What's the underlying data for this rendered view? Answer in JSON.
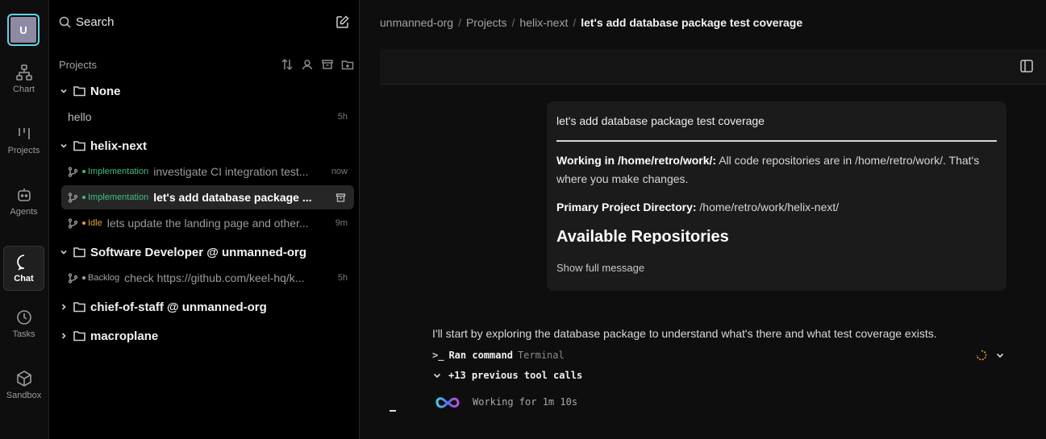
{
  "rail": {
    "avatar_letter": "U",
    "items": [
      {
        "label": "Chart",
        "icon": "chart-icon"
      },
      {
        "label": "Projects",
        "icon": "projects-icon"
      },
      {
        "label": "Agents",
        "icon": "agents-icon"
      },
      {
        "label": "Chat",
        "icon": "chat-icon",
        "active": true
      },
      {
        "label": "Tasks",
        "icon": "clock-icon"
      },
      {
        "label": "Sandbox",
        "icon": "cube-icon"
      }
    ]
  },
  "sidebar": {
    "search_label": "Search",
    "projects_header": "Projects",
    "folders": [
      {
        "name": "None",
        "expanded": true
      },
      {
        "name": "helix-next",
        "expanded": true
      },
      {
        "name": "Software Developer @ unmanned-org",
        "expanded": true
      },
      {
        "name": "chief-of-staff @ unmanned-org",
        "expanded": false
      },
      {
        "name": "macroplane",
        "expanded": false
      }
    ],
    "chats": {
      "hello": {
        "title": "hello",
        "time": "5h"
      },
      "ci": {
        "status": "Implementation",
        "title": "investigate CI integration test...",
        "time": "now"
      },
      "db": {
        "status": "Implementation",
        "title": "let's add database package ...",
        "active": true
      },
      "landing": {
        "status": "Idle",
        "title": "lets update the landing page and other...",
        "time": "9m"
      },
      "keel": {
        "status": "Backlog",
        "title": "check https://github.com/keel-hq/k...",
        "time": "5h"
      }
    }
  },
  "breadcrumb": {
    "org": "unmanned-org",
    "projects": "Projects",
    "project": "helix-next",
    "current": "let's add database package test coverage"
  },
  "message": {
    "title": "let's add database package test coverage",
    "working_label": "Working in /home/retro/work/:",
    "working_text": " All code repositories are in /home/retro/work/. That's where you make changes.",
    "primary_label": "Primary Project Directory:",
    "primary_text": " /home/retro/work/helix-next/",
    "section_heading": "Available Repositories",
    "show_full": "Show full message"
  },
  "assistant": {
    "reply": "I'll start by exploring the database package to understand what's there and what test coverage exists.",
    "tool_prompt": ">_",
    "tool_action": "Ran command",
    "tool_kind": "Terminal",
    "previous_calls": "+13 previous tool calls",
    "working_status": "Working for 1m 10s"
  },
  "colors": {
    "implementation": "#3fbf7f",
    "idle": "#e6a23c",
    "backlog": "#a3a3a3",
    "spinner": "#e8a23a",
    "avatar_border": "#5fd4e8"
  }
}
